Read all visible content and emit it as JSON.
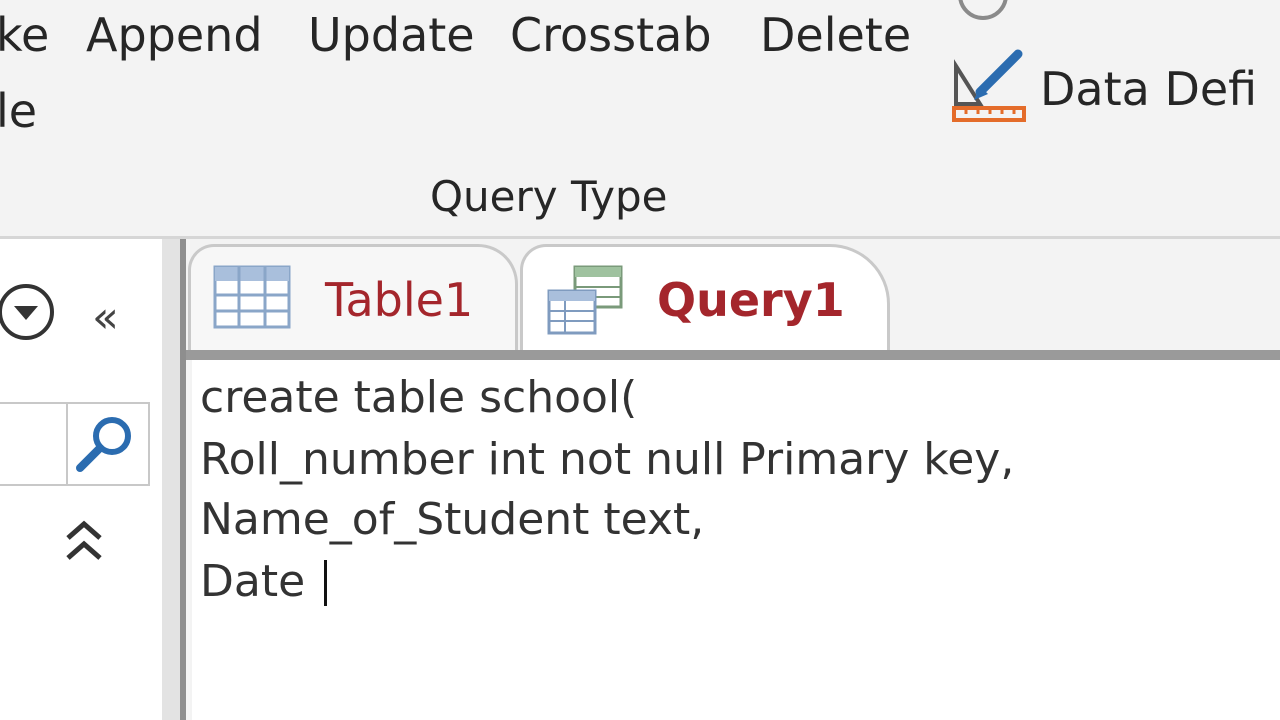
{
  "ribbon": {
    "buttons": {
      "make_table_partial": "ke",
      "make_table_partial_line2": "le",
      "append": "Append",
      "update": "Update",
      "crosstab": "Crosstab",
      "delete": "Delete",
      "data_definition_partial": "Data Defi"
    },
    "group_label": "Query Type"
  },
  "tabs": [
    {
      "label": "Table1",
      "icon": "table-icon",
      "active": false
    },
    {
      "label": "Query1",
      "icon": "query-icon",
      "active": true
    }
  ],
  "navigation": {
    "collapse_glyph": "«",
    "dropdown_icon": "chevron-down-circle-icon",
    "search_icon": "search-icon"
  },
  "editor": {
    "lines": [
      "create table school(",
      "Roll_number int not null Primary key,",
      "Name_of_Student text,",
      "Date "
    ]
  },
  "colors": {
    "tab_text": "#a4262c",
    "ribbon_bg": "#f3f3f3",
    "editor_bg": "#ffffff"
  }
}
